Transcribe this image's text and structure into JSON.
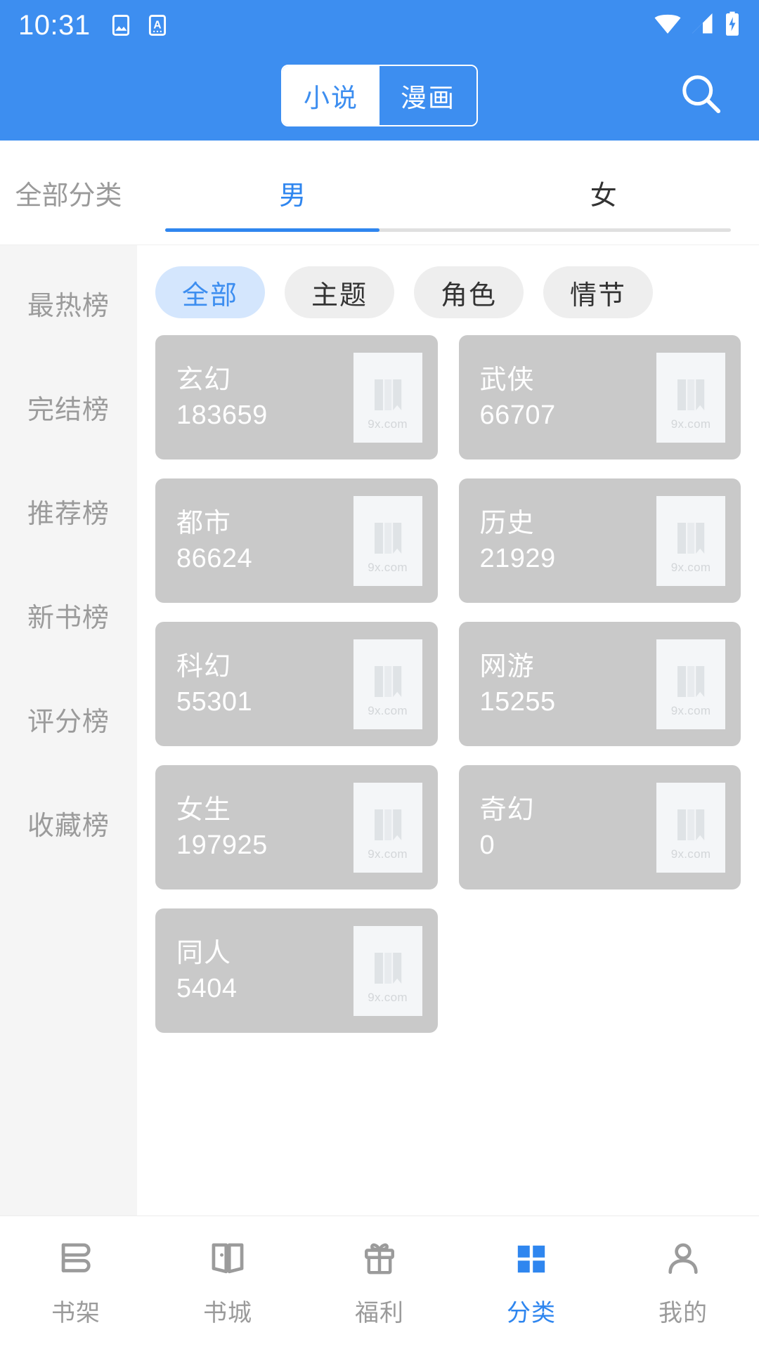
{
  "status_bar": {
    "time": "10:31",
    "left_icons": [
      "image-icon",
      "font-a-icon"
    ],
    "right_icons": [
      "wifi-icon",
      "signal-icon",
      "battery-charging-icon"
    ]
  },
  "header": {
    "segmented": {
      "options": [
        "小说",
        "漫画"
      ],
      "selected": "小说"
    },
    "search_icon": "search-icon",
    "background_color": "#3d8ef0"
  },
  "tab_bar": {
    "all_categories_label": "全部分类",
    "tabs": [
      {
        "label": "男",
        "active": true
      },
      {
        "label": "女",
        "active": false
      }
    ],
    "active_color": "#2f86ef"
  },
  "sidebar": {
    "items": [
      {
        "label": "最热榜"
      },
      {
        "label": "完结榜"
      },
      {
        "label": "推荐榜"
      },
      {
        "label": "新书榜"
      },
      {
        "label": "评分榜"
      },
      {
        "label": "收藏榜"
      }
    ]
  },
  "filter_chips": {
    "items": [
      {
        "label": "全部",
        "active": true
      },
      {
        "label": "主题",
        "active": false
      },
      {
        "label": "角色",
        "active": false
      },
      {
        "label": "情节",
        "active": false
      }
    ],
    "active_bg": "#d4e6fd",
    "active_fg": "#3d8ef0"
  },
  "category_grid": {
    "thumb_watermark": "9x.com",
    "card_bg": "#c9c9c9",
    "cards": [
      {
        "name": "玄幻",
        "count": "183659"
      },
      {
        "name": "武侠",
        "count": "66707"
      },
      {
        "name": "都市",
        "count": "86624"
      },
      {
        "name": "历史",
        "count": "21929"
      },
      {
        "name": "科幻",
        "count": "55301"
      },
      {
        "name": "网游",
        "count": "15255"
      },
      {
        "name": "女生",
        "count": "197925"
      },
      {
        "name": "奇幻",
        "count": "0"
      },
      {
        "name": "同人",
        "count": "5404"
      }
    ]
  },
  "bottom_nav": {
    "items": [
      {
        "label": "书架",
        "icon": "bookshelf-icon",
        "active": false
      },
      {
        "label": "书城",
        "icon": "open-book-icon",
        "active": false
      },
      {
        "label": "福利",
        "icon": "gift-icon",
        "active": false
      },
      {
        "label": "分类",
        "icon": "grid-category-icon",
        "active": true
      },
      {
        "label": "我的",
        "icon": "person-icon",
        "active": false
      }
    ],
    "active_color": "#2f86ef",
    "inactive_color": "#9b9b9b"
  }
}
